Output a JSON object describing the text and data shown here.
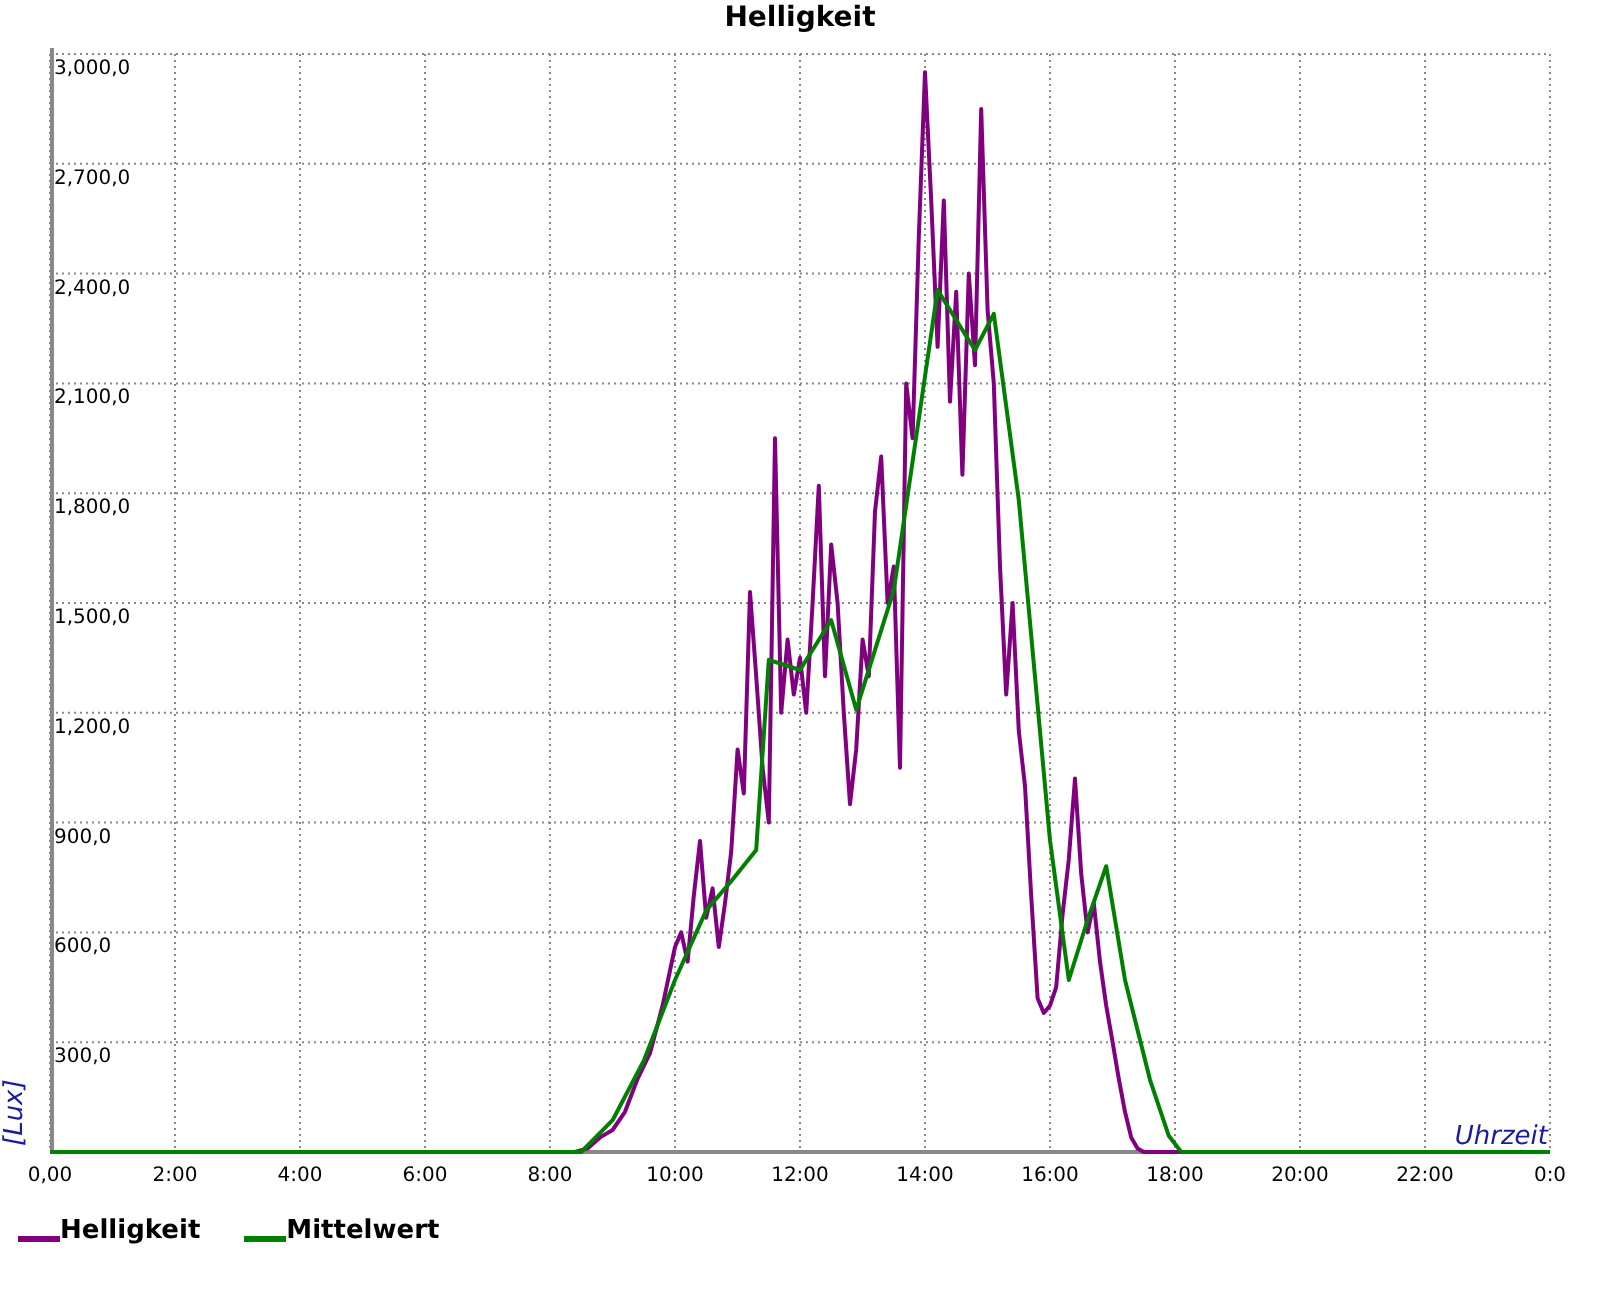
{
  "chart_data": {
    "type": "line",
    "title": "Helligkeit",
    "xlabel": "Uhrzeit",
    "ylabel": "[Lux]",
    "xlim": [
      0,
      24
    ],
    "ylim": [
      0,
      3000
    ],
    "grid": true,
    "xticks": [
      {
        "value": 0,
        "label": "0,00"
      },
      {
        "value": 2,
        "label": "2:00"
      },
      {
        "value": 4,
        "label": "4:00"
      },
      {
        "value": 6,
        "label": "6:00"
      },
      {
        "value": 8,
        "label": "8:00"
      },
      {
        "value": 10,
        "label": "10:00"
      },
      {
        "value": 12,
        "label": "12:00"
      },
      {
        "value": 14,
        "label": "14:00"
      },
      {
        "value": 16,
        "label": "16:00"
      },
      {
        "value": 18,
        "label": "18:00"
      },
      {
        "value": 20,
        "label": "20:00"
      },
      {
        "value": 22,
        "label": "22:00"
      },
      {
        "value": 24,
        "label": "0:0"
      }
    ],
    "yticks": [
      {
        "value": 300,
        "label": "300,0"
      },
      {
        "value": 600,
        "label": "600,0"
      },
      {
        "value": 900,
        "label": "900,0"
      },
      {
        "value": 1200,
        "label": "1,200,0"
      },
      {
        "value": 1500,
        "label": "1,500,0"
      },
      {
        "value": 1800,
        "label": "1,800,0"
      },
      {
        "value": 2100,
        "label": "2,100,0"
      },
      {
        "value": 2400,
        "label": "2,400,0"
      },
      {
        "value": 2700,
        "label": "2,700,0"
      },
      {
        "value": 3000,
        "label": "3,000,0"
      }
    ],
    "series": [
      {
        "name": "Helligkeit",
        "color": "#800080",
        "x": [
          0,
          8.4,
          8.6,
          8.8,
          9.0,
          9.2,
          9.4,
          9.6,
          9.8,
          10.0,
          10.1,
          10.2,
          10.3,
          10.4,
          10.5,
          10.6,
          10.7,
          10.8,
          10.9,
          11.0,
          11.1,
          11.2,
          11.3,
          11.4,
          11.5,
          11.6,
          11.7,
          11.8,
          11.9,
          12.0,
          12.1,
          12.2,
          12.3,
          12.4,
          12.5,
          12.6,
          12.7,
          12.8,
          12.9,
          13.0,
          13.1,
          13.2,
          13.3,
          13.4,
          13.5,
          13.6,
          13.7,
          13.8,
          13.9,
          14.0,
          14.1,
          14.2,
          14.3,
          14.4,
          14.5,
          14.6,
          14.7,
          14.8,
          14.9,
          15.0,
          15.1,
          15.2,
          15.3,
          15.4,
          15.5,
          15.6,
          15.7,
          15.8,
          15.9,
          16.0,
          16.1,
          16.2,
          16.3,
          16.4,
          16.5,
          16.6,
          16.7,
          16.8,
          16.9,
          17.0,
          17.1,
          17.2,
          17.3,
          17.4,
          17.5,
          24
        ],
        "values": [
          0,
          0,
          10,
          40,
          60,
          110,
          200,
          270,
          400,
          560,
          600,
          520,
          700,
          850,
          640,
          720,
          560,
          680,
          820,
          1100,
          980,
          1530,
          1300,
          1050,
          900,
          1950,
          1200,
          1400,
          1250,
          1350,
          1200,
          1500,
          1820,
          1300,
          1660,
          1500,
          1200,
          950,
          1100,
          1400,
          1300,
          1750,
          1900,
          1500,
          1600,
          1050,
          2100,
          1950,
          2500,
          2950,
          2600,
          2200,
          2600,
          2050,
          2350,
          1850,
          2400,
          2150,
          2850,
          2300,
          2100,
          1600,
          1250,
          1500,
          1150,
          1000,
          700,
          420,
          380,
          400,
          450,
          650,
          800,
          1020,
          760,
          600,
          680,
          520,
          400,
          300,
          200,
          110,
          40,
          10,
          0,
          0
        ]
      },
      {
        "name": "Mittelwert",
        "color": "#008000",
        "x": [
          0,
          8.5,
          9.0,
          9.5,
          10.0,
          10.5,
          10.9,
          11.3,
          11.5,
          12.0,
          12.5,
          12.9,
          13.5,
          14.2,
          14.6,
          14.8,
          15.1,
          15.5,
          16.0,
          16.3,
          16.6,
          16.9,
          17.2,
          17.6,
          17.9,
          18.1,
          24
        ],
        "values": [
          0,
          0,
          87,
          250,
          470,
          660,
          740,
          825,
          1345,
          1317,
          1453,
          1208,
          1535,
          2355,
          2246,
          2191,
          2290,
          1781,
          852,
          470,
          634,
          781,
          470,
          197,
          44,
          0,
          0
        ]
      }
    ]
  }
}
